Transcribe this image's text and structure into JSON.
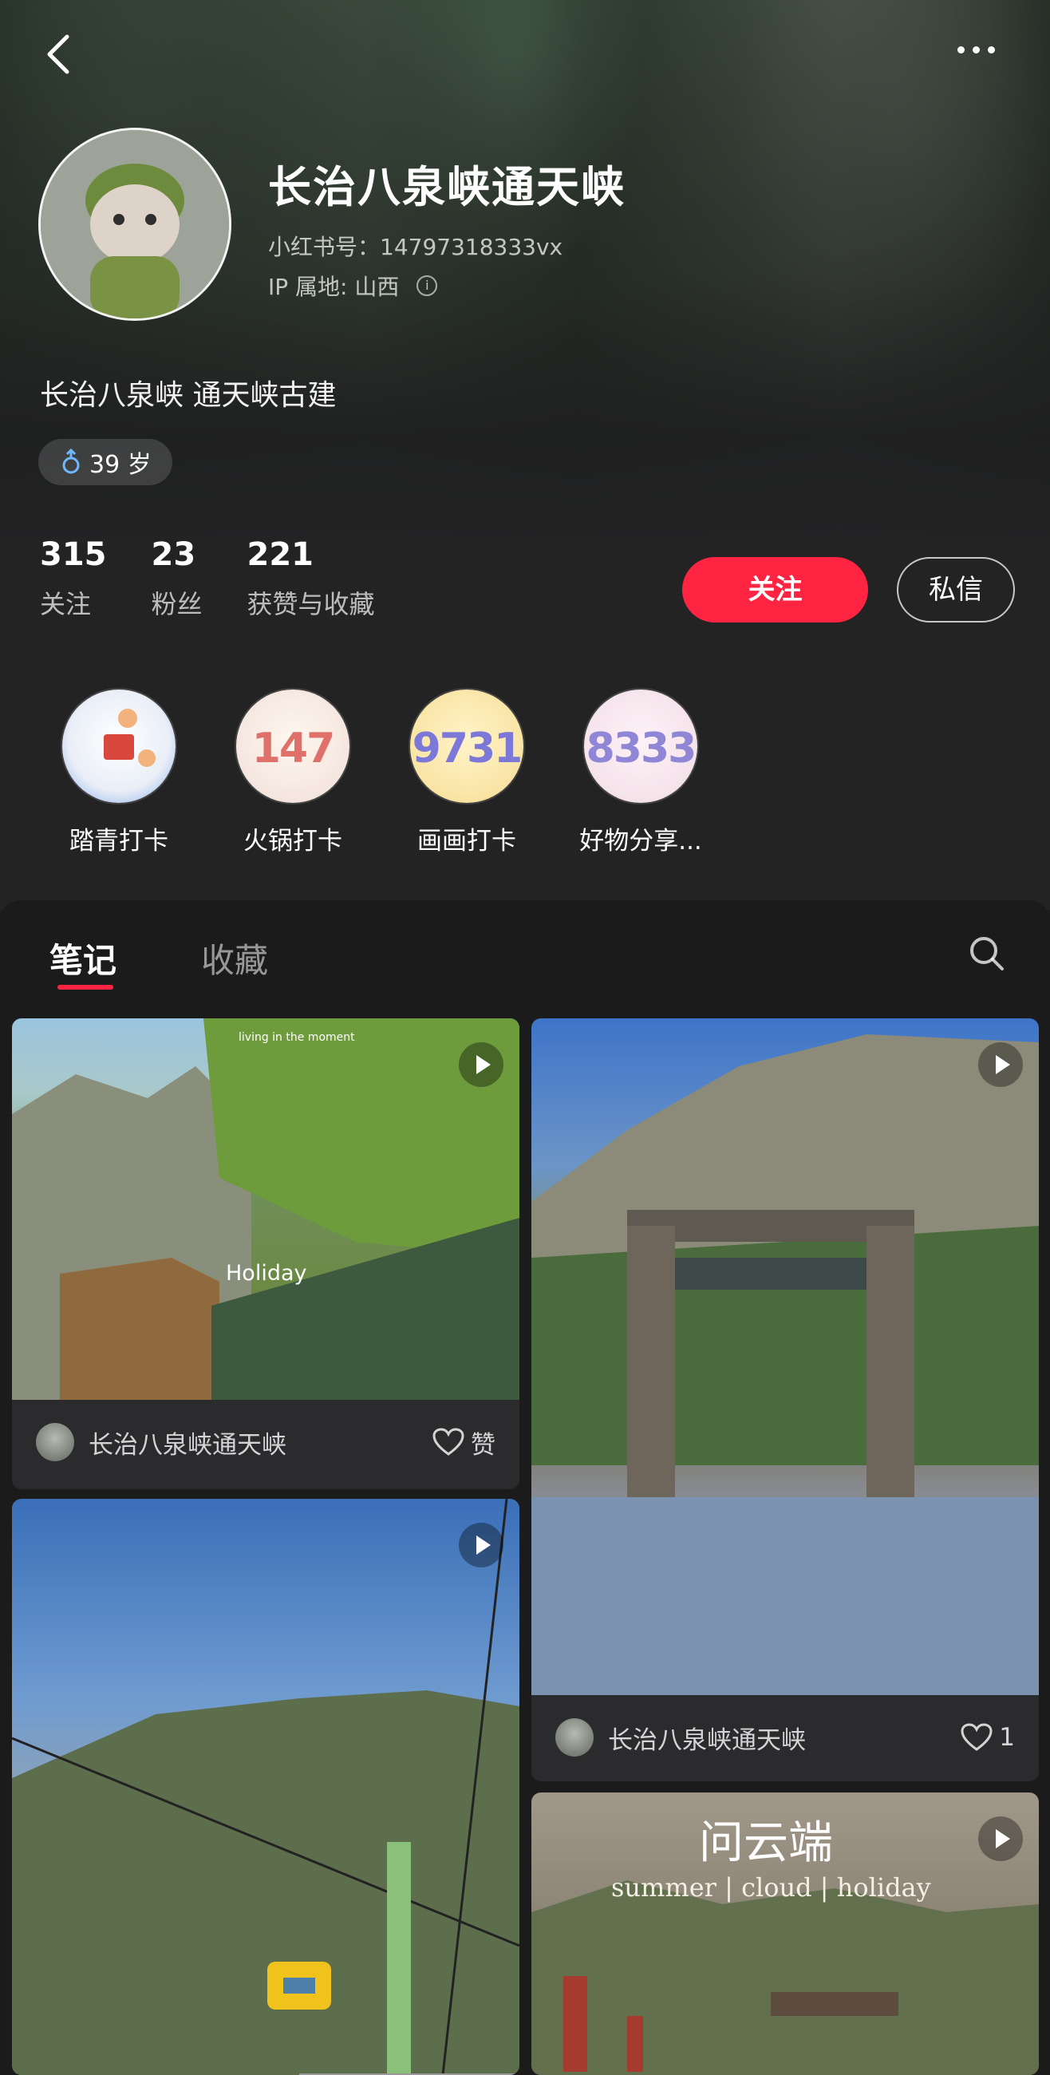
{
  "profile": {
    "name": "长治八泉峡通天峡",
    "xhs_id": "小红书号：14797318333vx",
    "ip_location": "IP 属地: 山西",
    "bio": "长治八泉峡 通天峡古建",
    "age_tag": "39 岁"
  },
  "stats": [
    {
      "value": "315",
      "label": "关注"
    },
    {
      "value": "23",
      "label": "粉丝"
    },
    {
      "value": "221",
      "label": "获赞与收藏"
    }
  ],
  "actions": {
    "follow": "关注",
    "message": "私信"
  },
  "collections": [
    {
      "label": "踏青打卡",
      "cover_text": ""
    },
    {
      "label": "火锅打卡",
      "cover_text": "147"
    },
    {
      "label": "画画打卡",
      "cover_text": "9731"
    },
    {
      "label": "好物分享...",
      "cover_text": "8333"
    }
  ],
  "tabs": {
    "notes": "笔记",
    "collect": "收藏"
  },
  "cards": [
    {
      "author": "长治八泉峡通天峡",
      "likes": "赞",
      "overlay_title": "Holiday",
      "overlay_sub": "living in the moment"
    },
    {
      "author": "长治八泉峡通天峡",
      "likes": "1",
      "overlay_title": "",
      "overlay_sub": ""
    },
    {
      "author": "",
      "likes": "",
      "overlay_title": "",
      "overlay_sub": ""
    },
    {
      "author": "",
      "likes": "",
      "overlay_title": "问云端",
      "overlay_sub": "summer | cloud | holiday"
    }
  ],
  "colors": {
    "accent": "#ff2442",
    "background": "#1e1e1f"
  }
}
